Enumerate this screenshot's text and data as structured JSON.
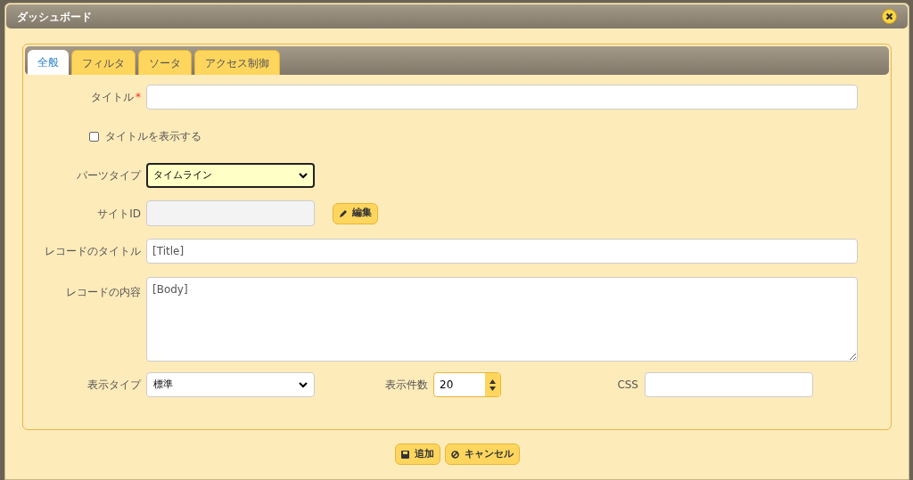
{
  "dialog": {
    "title": "ダッシュボード"
  },
  "tabs": [
    {
      "label": "全般",
      "selected": true
    },
    {
      "label": "フィルタ",
      "selected": false
    },
    {
      "label": "ソータ",
      "selected": false
    },
    {
      "label": "アクセス制御",
      "selected": false
    }
  ],
  "form": {
    "title": {
      "label": "タイトル",
      "required_mark": "*"
    },
    "show_title": {
      "label": "タイトルを表示する",
      "checked": false
    },
    "parts_type": {
      "label": "パーツタイプ",
      "value": "タイムライン"
    },
    "site_id": {
      "label": "サイトID",
      "disabled": true,
      "button": "編集"
    },
    "record_title": {
      "label": "レコードのタイトル",
      "value": "[Title]"
    },
    "record_body": {
      "label": "レコードの内容",
      "value": "[Body]"
    },
    "display_type": {
      "label": "表示タイプ",
      "value": "標準"
    },
    "display_count": {
      "label": "表示件数",
      "value": "20"
    },
    "css": {
      "label": "CSS"
    }
  },
  "buttons": [
    {
      "kind": "save",
      "label": "追加"
    },
    {
      "kind": "cancel",
      "label": "キャンセル"
    }
  ]
}
